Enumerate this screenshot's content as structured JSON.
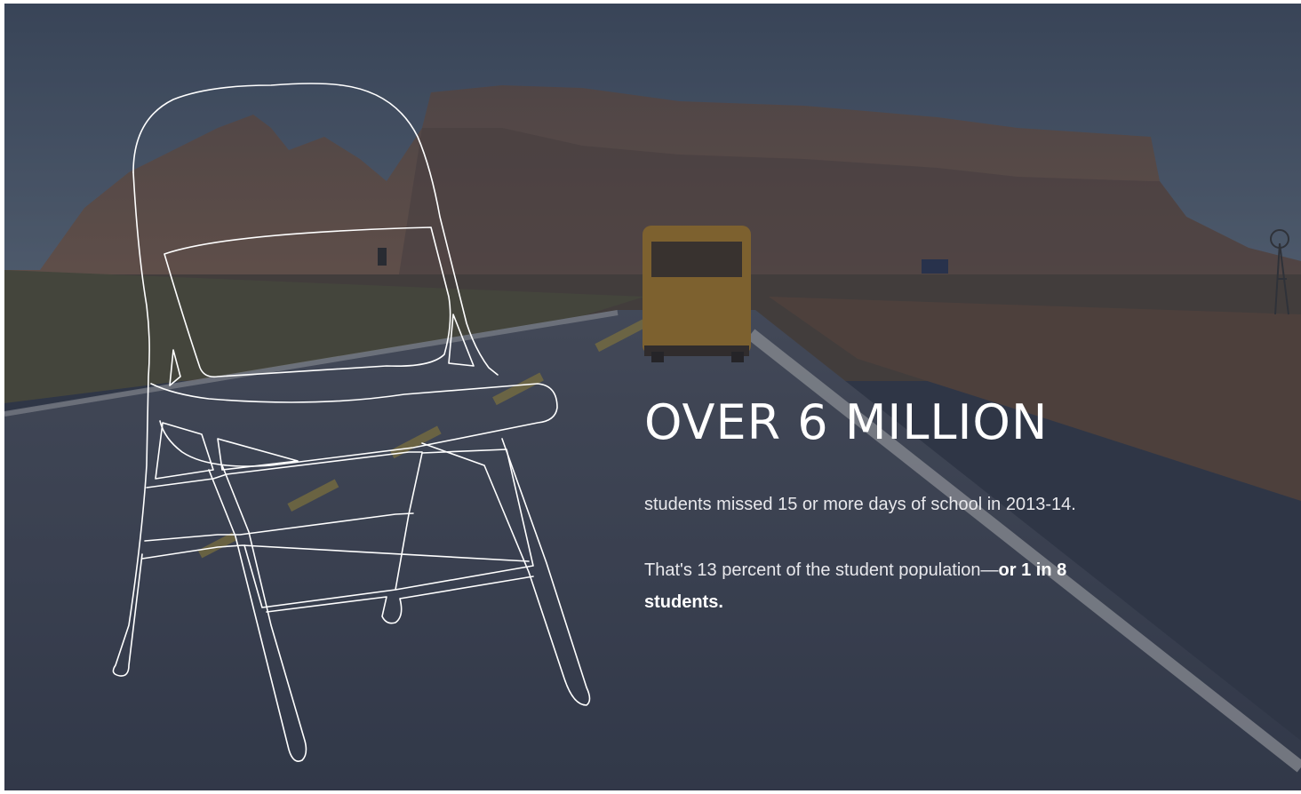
{
  "hero": {
    "headline": "OVER 6 MILLION",
    "statement": "students missed 15 or more days of school in 2013-14.",
    "detail_plain": "That's 13 percent of the student population—",
    "detail_strong": "or 1 in 8 students."
  },
  "colors": {
    "sky": "#4f5f75",
    "mesa": "#7a5a45",
    "road": "#4b5162",
    "bus": "#b88a2a",
    "text": "#ffffff"
  },
  "icons": {
    "chair": "folding-chair-outline-icon"
  }
}
